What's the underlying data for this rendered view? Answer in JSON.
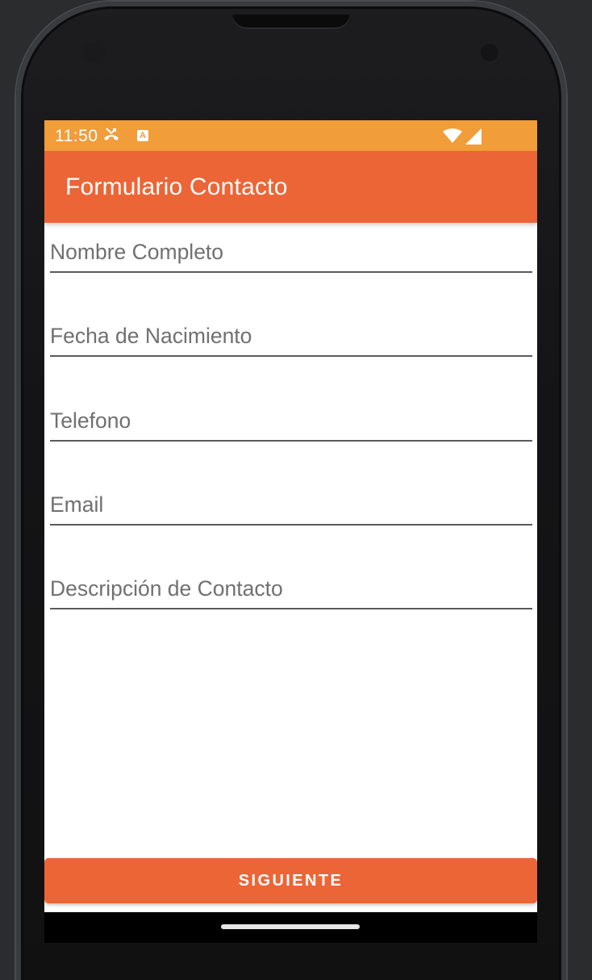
{
  "status_bar": {
    "time": "11:50",
    "icons": [
      "missed-call-icon",
      "a-notification-icon",
      "wifi-icon",
      "signal-icon"
    ],
    "background": "#f19d3a"
  },
  "app_bar": {
    "title": "Formulario Contacto",
    "background": "#ec6537"
  },
  "form": {
    "fields": [
      {
        "placeholder": "Nombre Completo",
        "value": ""
      },
      {
        "placeholder": "Fecha de Nacimiento",
        "value": ""
      },
      {
        "placeholder": "Telefono",
        "value": ""
      },
      {
        "placeholder": "Email",
        "value": ""
      },
      {
        "placeholder": "Descripción de Contacto",
        "value": ""
      }
    ]
  },
  "button": {
    "label": "SIGUIENTE",
    "background": "#ec6537"
  },
  "colors": {
    "accent": "#ec6537",
    "status": "#f19d3a"
  }
}
